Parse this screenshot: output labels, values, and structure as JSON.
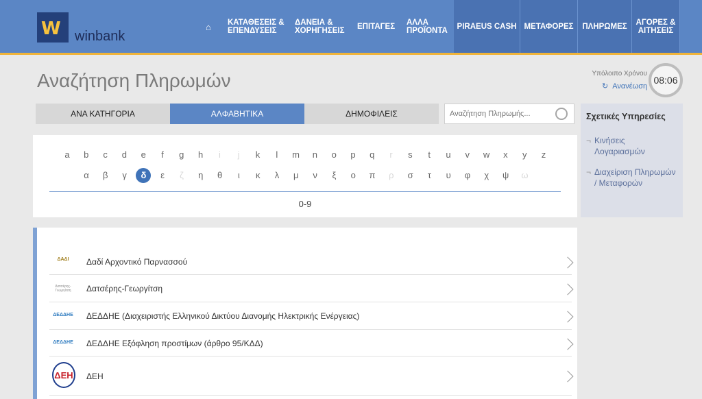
{
  "header": {
    "logo_text": "winbank",
    "logo_mark": "W",
    "nav": [
      {
        "label": "ΚΑΤΑΘΕΣΕΙΣ & ΕΠΕΝΔΥΣΕΙΣ"
      },
      {
        "label": "ΔΑΝΕΙΑ & ΧΟΡΗΓΗΣΕΙΣ"
      },
      {
        "label": "ΕΠΙΤΑΓΕΣ"
      },
      {
        "label": "ΑΛΛΑ ΠΡΟΪΟΝΤΑ"
      },
      {
        "label": "PIRAEUS CASH"
      },
      {
        "label": "ΜΕΤΑΦΟΡΕΣ"
      },
      {
        "label": "ΠΛΗΡΩΜΕΣ"
      },
      {
        "label": "ΑΓΟΡΕΣ & ΑΙΤΗΣΕΙΣ"
      }
    ],
    "home_icon": "home-icon"
  },
  "page": {
    "title": "Αναζήτηση Πληρωμών"
  },
  "session": {
    "remaining_label": "Υπόλοιπο Χρόνου",
    "refresh_label": "Ανανέωση",
    "time": "08:06"
  },
  "tabs": [
    {
      "label": "ΑΝΑ ΚΑΤΗΓΟΡΙΑ",
      "active": false
    },
    {
      "label": "ΑΛΦΑΒΗΤΙΚΑ",
      "active": true
    },
    {
      "label": "ΔΗΜΟΦΙΛΕΙΣ",
      "active": false
    }
  ],
  "search": {
    "placeholder": "Αναζήτηση Πληρωμής..."
  },
  "alphabet": {
    "latin": [
      "a",
      "b",
      "c",
      "d",
      "e",
      "f",
      "g",
      "h",
      "i",
      "j",
      "k",
      "l",
      "m",
      "n",
      "o",
      "p",
      "q",
      "r",
      "s",
      "t",
      "u",
      "v",
      "w",
      "x",
      "y",
      "z"
    ],
    "latin_disabled": [
      "i",
      "j",
      "r"
    ],
    "greek": [
      "α",
      "β",
      "γ",
      "δ",
      "ε",
      "ζ",
      "η",
      "θ",
      "ι",
      "κ",
      "λ",
      "μ",
      "ν",
      "ξ",
      "ο",
      "π",
      "ρ",
      "σ",
      "τ",
      "υ",
      "φ",
      "χ",
      "ψ",
      "ω"
    ],
    "greek_disabled": [
      "ζ",
      "ρ",
      "ω"
    ],
    "active": "δ",
    "digits": "0-9"
  },
  "sidebar": {
    "title": "Σχετικές Υπηρεσίες",
    "items": [
      {
        "label": "Κινήσεις Λογαριασμών"
      },
      {
        "label": "Διαχείριση Πληρωμών / Μεταφορών"
      }
    ]
  },
  "results": [
    {
      "name": "Δαδί Αρχοντικό Παρνασσού",
      "logo": "ΔΑΔΙ"
    },
    {
      "name": "Δατσέρης-Γεωργίτση",
      "logo": "Δατσέρης-Γεωργίτση"
    },
    {
      "name": "ΔΕΔΔΗΕ (Διαχειριστής Ελληνικού Δικτύου Διανομής Ηλεκτρικής Ενέργειας)",
      "logo": "ΔΕΔΔΗΕ"
    },
    {
      "name": "ΔΕΔΔΗΕ Εξόφληση προστίμων (άρθρο 95/ΚΔΔ)",
      "logo": "ΔΕΔΔΗΕ"
    },
    {
      "name": "ΔΕΗ",
      "logo": "ΔΕΗ"
    }
  ]
}
